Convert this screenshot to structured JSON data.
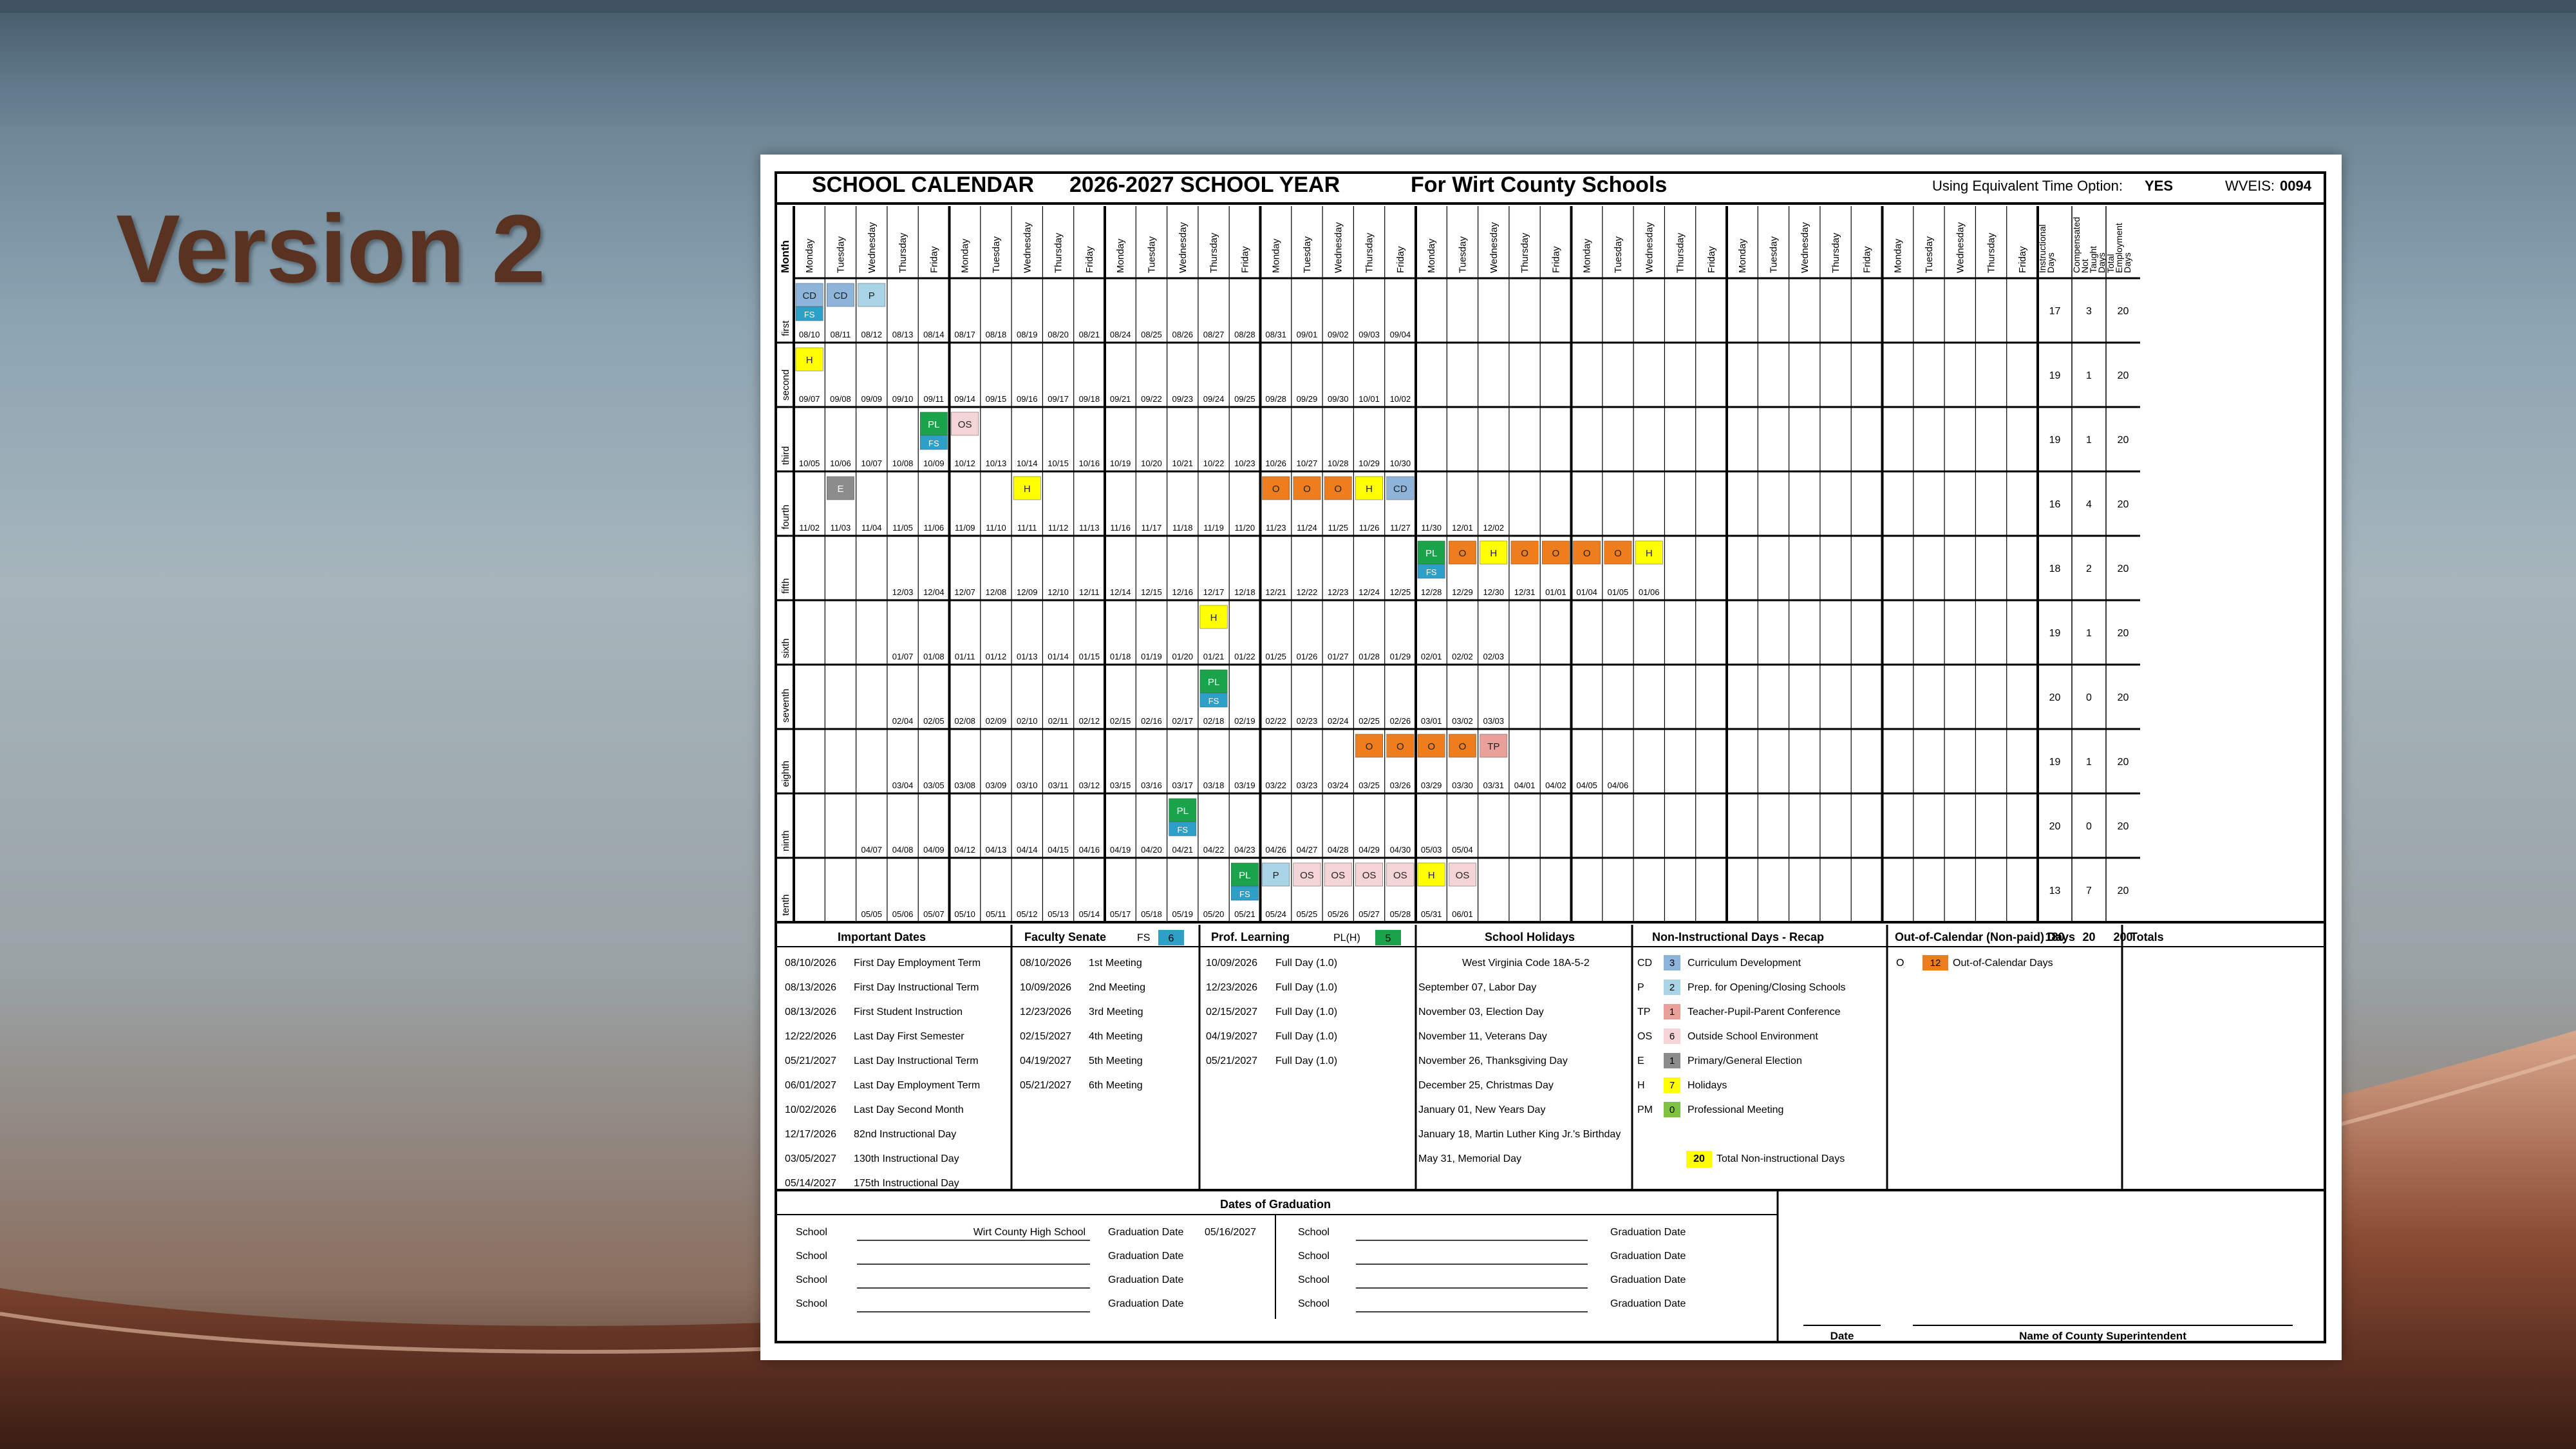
{
  "slide": {
    "title": "Version 2"
  },
  "calendar": {
    "heading": "SCHOOL CALENDAR",
    "year": "2026-2027 SCHOOL YEAR",
    "county": "For Wirt County Schools",
    "option_label": "Using Equivalent Time Option:",
    "option_value": "YES",
    "wveis_label": "WVEIS:",
    "wveis_value": "0094",
    "col_month": "Month",
    "day_headers": [
      "Monday",
      "Tuesday",
      "Wednesday",
      "Thursday",
      "Friday"
    ],
    "total_headers": [
      "Instructional Days",
      "Compensated Not Taught Days",
      "Total Employment Days"
    ],
    "months": [
      {
        "name": "first",
        "dates": [
          "08/10",
          "08/11",
          "08/12",
          "08/13",
          "08/14",
          "08/17",
          "08/18",
          "08/19",
          "08/20",
          "08/21",
          "08/24",
          "08/25",
          "08/26",
          "08/27",
          "08/28",
          "08/31",
          "09/01",
          "09/02",
          "09/03",
          "09/04"
        ],
        "start": 0,
        "codes": [
          {
            "i": 0,
            "c": "CD",
            "b": "FS"
          },
          {
            "i": 1,
            "c": "CD"
          },
          {
            "i": 2,
            "c": "P"
          }
        ],
        "totals": [
          "17",
          "3",
          "20"
        ]
      },
      {
        "name": "second",
        "dates": [
          "09/07",
          "09/08",
          "09/09",
          "09/10",
          "09/11",
          "09/14",
          "09/15",
          "09/16",
          "09/17",
          "09/18",
          "09/21",
          "09/22",
          "09/23",
          "09/24",
          "09/25",
          "09/28",
          "09/29",
          "09/30",
          "10/01",
          "10/02"
        ],
        "start": 0,
        "codes": [
          {
            "i": 0,
            "c": "H"
          }
        ],
        "totals": [
          "19",
          "1",
          "20"
        ]
      },
      {
        "name": "third",
        "dates": [
          "10/05",
          "10/06",
          "10/07",
          "10/08",
          "10/09",
          "10/12",
          "10/13",
          "10/14",
          "10/15",
          "10/16",
          "10/19",
          "10/20",
          "10/21",
          "10/22",
          "10/23",
          "10/26",
          "10/27",
          "10/28",
          "10/29",
          "10/30"
        ],
        "start": 0,
        "codes": [
          {
            "i": 4,
            "c": "PL",
            "b": "FS"
          },
          {
            "i": 5,
            "c": "OS"
          }
        ],
        "totals": [
          "19",
          "1",
          "20"
        ]
      },
      {
        "name": "fourth",
        "dates": [
          "11/02",
          "11/03",
          "11/04",
          "11/05",
          "11/06",
          "11/09",
          "11/10",
          "11/11",
          "11/12",
          "11/13",
          "11/16",
          "11/17",
          "11/18",
          "11/19",
          "11/20",
          "11/23",
          "11/24",
          "11/25",
          "11/26",
          "11/27",
          "11/30",
          "12/01",
          "12/02"
        ],
        "start": 0,
        "codes": [
          {
            "i": 1,
            "c": "E"
          },
          {
            "i": 7,
            "c": "H"
          },
          {
            "i": 15,
            "c": "O"
          },
          {
            "i": 16,
            "c": "O"
          },
          {
            "i": 17,
            "c": "O"
          },
          {
            "i": 18,
            "c": "H"
          },
          {
            "i": 19,
            "c": "CD"
          }
        ],
        "totals": [
          "16",
          "4",
          "20"
        ]
      },
      {
        "name": "fifth",
        "dates": [
          "12/03",
          "12/04",
          "12/07",
          "12/08",
          "12/09",
          "12/10",
          "12/11",
          "12/14",
          "12/15",
          "12/16",
          "12/17",
          "12/18",
          "12/21",
          "12/22",
          "12/23",
          "12/24",
          "12/25",
          "12/28",
          "12/29",
          "12/30",
          "12/31",
          "01/01",
          "01/04",
          "01/05",
          "01/06"
        ],
        "start": 3,
        "codes": [
          {
            "i": 17,
            "c": "PL",
            "b": "FS"
          },
          {
            "i": 18,
            "c": "O"
          },
          {
            "i": 19,
            "c": "H"
          },
          {
            "i": 20,
            "c": "O"
          },
          {
            "i": 21,
            "c": "O"
          },
          {
            "i": 22,
            "c": "O"
          },
          {
            "i": 23,
            "c": "O"
          },
          {
            "i": 24,
            "c": "H"
          }
        ],
        "totals": [
          "18",
          "2",
          "20"
        ]
      },
      {
        "name": "sixth",
        "dates": [
          "01/07",
          "01/08",
          "01/11",
          "01/12",
          "01/13",
          "01/14",
          "01/15",
          "01/18",
          "01/19",
          "01/20",
          "01/21",
          "01/22",
          "01/25",
          "01/26",
          "01/27",
          "01/28",
          "01/29",
          "02/01",
          "02/02",
          "02/03"
        ],
        "start": 3,
        "codes": [
          {
            "i": 10,
            "c": "H"
          }
        ],
        "totals": [
          "19",
          "1",
          "20"
        ]
      },
      {
        "name": "seventh",
        "dates": [
          "02/04",
          "02/05",
          "02/08",
          "02/09",
          "02/10",
          "02/11",
          "02/12",
          "02/15",
          "02/16",
          "02/17",
          "02/18",
          "02/19",
          "02/22",
          "02/23",
          "02/24",
          "02/25",
          "02/26",
          "03/01",
          "03/02",
          "03/03"
        ],
        "start": 3,
        "codes": [
          {
            "i": 10,
            "c": "PL",
            "b": "FS"
          }
        ],
        "totals": [
          "20",
          "0",
          "20"
        ]
      },
      {
        "name": "eighth",
        "dates": [
          "03/04",
          "03/05",
          "03/08",
          "03/09",
          "03/10",
          "03/11",
          "03/12",
          "03/15",
          "03/16",
          "03/17",
          "03/18",
          "03/19",
          "03/22",
          "03/23",
          "03/24",
          "03/25",
          "03/26",
          "03/29",
          "03/30",
          "03/31",
          "04/01",
          "04/02",
          "04/05",
          "04/06"
        ],
        "start": 3,
        "codes": [
          {
            "i": 15,
            "c": "O"
          },
          {
            "i": 16,
            "c": "O"
          },
          {
            "i": 17,
            "c": "O"
          },
          {
            "i": 18,
            "c": "O"
          },
          {
            "i": 19,
            "c": "TP"
          }
        ],
        "totals": [
          "19",
          "1",
          "20"
        ]
      },
      {
        "name": "ninth",
        "dates": [
          "04/07",
          "04/08",
          "04/09",
          "04/12",
          "04/13",
          "04/14",
          "04/15",
          "04/16",
          "04/19",
          "04/20",
          "04/21",
          "04/22",
          "04/23",
          "04/26",
          "04/27",
          "04/28",
          "04/29",
          "04/30",
          "05/03",
          "05/04"
        ],
        "start": 2,
        "codes": [
          {
            "i": 10,
            "c": "PL",
            "b": "FS"
          }
        ],
        "totals": [
          "20",
          "0",
          "20"
        ]
      },
      {
        "name": "tenth",
        "dates": [
          "05/05",
          "05/06",
          "05/07",
          "05/10",
          "05/11",
          "05/12",
          "05/13",
          "05/14",
          "05/17",
          "05/18",
          "05/19",
          "05/20",
          "05/21",
          "05/24",
          "05/25",
          "05/26",
          "05/27",
          "05/28",
          "05/31",
          "06/01"
        ],
        "start": 2,
        "codes": [
          {
            "i": 12,
            "c": "PL",
            "b": "FS"
          },
          {
            "i": 13,
            "c": "P"
          },
          {
            "i": 14,
            "c": "OS"
          },
          {
            "i": 15,
            "c": "OS"
          },
          {
            "i": 16,
            "c": "OS"
          },
          {
            "i": 17,
            "c": "OS"
          },
          {
            "i": 18,
            "c": "H"
          },
          {
            "i": 19,
            "c": "OS"
          }
        ],
        "totals": [
          "13",
          "7",
          "20"
        ]
      }
    ],
    "code_colors": {
      "CD": "#8fb4d9",
      "P": "#a9d4e6",
      "H": "#ffff00",
      "PL": "#1aa34a",
      "OS": "#f4d4d4",
      "E": "#8c8c8c",
      "O": "#ee7d1e",
      "TP": "#e9a09a",
      "FS": "#2e9fc6"
    },
    "sections": {
      "important": {
        "title": "Important Dates",
        "rows": [
          [
            "08/10/2026",
            "First Day Employment Term"
          ],
          [
            "08/13/2026",
            "First Day Instructional Term"
          ],
          [
            "08/13/2026",
            "First Student Instruction"
          ],
          [
            "12/22/2026",
            "Last Day First Semester"
          ],
          [
            "05/21/2027",
            "Last Day Instructional Term"
          ],
          [
            "06/01/2027",
            "Last Day Employment Term"
          ],
          [
            "10/02/2026",
            "Last Day Second Month"
          ],
          [
            "12/17/2026",
            "82nd Instructional Day"
          ],
          [
            "03/05/2027",
            "130th Instructional Day"
          ],
          [
            "05/14/2027",
            "175th Instructional Day"
          ]
        ]
      },
      "faculty": {
        "title": "Faculty Senate",
        "code": "FS",
        "count": "6",
        "rows": [
          [
            "08/10/2026",
            "1st Meeting"
          ],
          [
            "10/09/2026",
            "2nd Meeting"
          ],
          [
            "12/23/2026",
            "3rd Meeting"
          ],
          [
            "02/15/2027",
            "4th Meeting"
          ],
          [
            "04/19/2027",
            "5th Meeting"
          ],
          [
            "05/21/2027",
            "6th Meeting"
          ]
        ]
      },
      "prof": {
        "title": "Prof. Learning",
        "code": "PL(H)",
        "count": "5",
        "rows": [
          [
            "10/09/2026",
            "Full Day (1.0)"
          ],
          [
            "12/23/2026",
            "Full Day (1.0)"
          ],
          [
            "02/15/2027",
            "Full Day (1.0)"
          ],
          [
            "04/19/2027",
            "Full Day (1.0)"
          ],
          [
            "05/21/2027",
            "Full Day (1.0)"
          ]
        ]
      },
      "holidays": {
        "title": "School Holidays",
        "rows": [
          "West Virginia Code 18A-5-2",
          "September 07, Labor Day",
          "November 03, Election Day",
          "November 11, Veterans Day",
          "November 26, Thanksgiving Day",
          "December 25, Christmas Day",
          "January 01, New Years Day",
          "January 18, Martin Luther King Jr.'s Birthday",
          "May 31, Memorial Day"
        ]
      },
      "recap": {
        "title": "Non-Instructional Days - Recap",
        "rows": [
          [
            "CD",
            "3",
            "Curriculum Development",
            "#8fb4d9"
          ],
          [
            "P",
            "2",
            "Prep. for Opening/Closing Schools",
            "#a9d4e6"
          ],
          [
            "TP",
            "1",
            "Teacher-Pupil-Parent Conference",
            "#e9a09a"
          ],
          [
            "OS",
            "6",
            "Outside School Environment",
            "#f4d4d4"
          ],
          [
            "E",
            "1",
            "Primary/General Election",
            "#8c8c8c"
          ],
          [
            "H",
            "7",
            "Holidays",
            "#ffff00"
          ],
          [
            "PM",
            "0",
            "Professional Meeting",
            "#7fc241"
          ]
        ],
        "total_count": "20",
        "total_label": "Total Non-instructional Days"
      },
      "out": {
        "title": "Out-of-Calendar (Non-paid) Days",
        "code": "O",
        "count": "12",
        "label": "Out-of-Calendar Days"
      },
      "totals": {
        "title": "Totals",
        "values": [
          "180",
          "20",
          "200"
        ]
      }
    },
    "graduation": {
      "title": "Dates of Graduation",
      "school_label": "School",
      "date_label": "Graduation Date",
      "left": [
        {
          "school": "Wirt County High School",
          "date": "05/16/2027"
        },
        {
          "school": "",
          "date": ""
        },
        {
          "school": "",
          "date": ""
        },
        {
          "school": "",
          "date": ""
        }
      ],
      "right": [
        {
          "school": "",
          "date": ""
        },
        {
          "school": "",
          "date": ""
        },
        {
          "school": "",
          "date": ""
        },
        {
          "school": "",
          "date": ""
        }
      ],
      "sign_date": "Date",
      "sign_name": "Name of County Superintendent"
    }
  }
}
